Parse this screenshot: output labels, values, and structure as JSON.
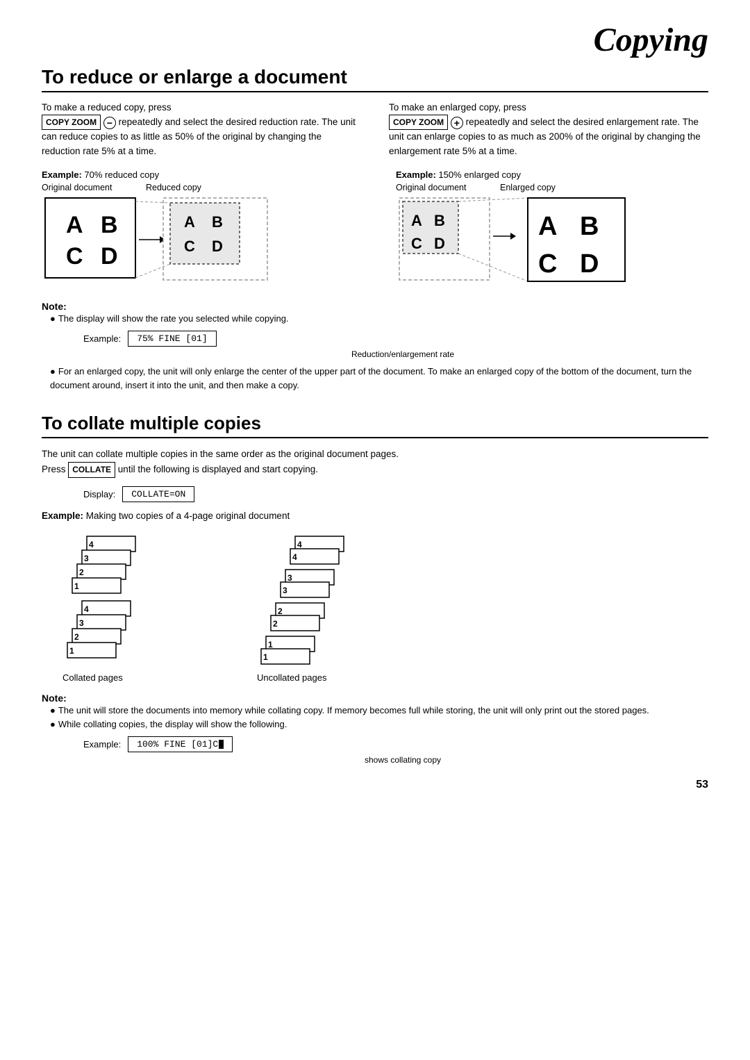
{
  "page": {
    "title": "Copying",
    "page_number": "53"
  },
  "section1": {
    "heading": "To reduce or enlarge a document",
    "left_col": {
      "intro": "To make a reduced copy, press",
      "button": "COPY ZOOM",
      "arrow_symbol": "−",
      "rest": "repeatedly and select the desired reduction rate. The unit can reduce copies to as little as 50% of the original by changing the reduction rate 5% at a time."
    },
    "right_col": {
      "intro": "To make an enlarged copy, press",
      "button": "COPY ZOOM",
      "arrow_symbol": "+",
      "rest": "repeatedly and select the desired enlargement rate. The unit can enlarge copies to as much as 200% of the original by changing the enlargement rate 5% at a time."
    },
    "reduce_example": {
      "label_bold": "Example:",
      "label_rest": " 70% reduced copy",
      "orig_label": "Original document",
      "copy_label": "Reduced copy",
      "orig_letters": [
        "A",
        "B",
        "C",
        "D"
      ],
      "copy_letters": [
        "A",
        "B",
        "C",
        "D"
      ]
    },
    "enlarge_example": {
      "label_bold": "Example:",
      "label_rest": " 150% enlarged copy",
      "orig_label": "Original document",
      "copy_label": "Enlarged copy",
      "orig_letters": [
        "A",
        "B",
        "C",
        "D"
      ],
      "copy_letters": [
        "A",
        "B",
        "C",
        "D"
      ]
    },
    "note_title": "Note:",
    "note1": "The display will show the rate you selected while copying.",
    "display_example_prefix": "Example:",
    "display_example_value": "75% FINE  [01]",
    "display_sub": "Reduction/enlargement rate",
    "note2": "For an enlarged copy, the unit will only enlarge the center of the upper part of the document. To make an enlarged copy of the bottom of the document, turn the document around, insert it into the unit, and then make a copy."
  },
  "section2": {
    "heading": "To collate multiple copies",
    "intro1": "The unit can collate multiple copies in the same order as the original document pages.",
    "intro2_pre": "Press ",
    "intro2_button": "COLLATE",
    "intro2_post": " until the following is displayed and start copying.",
    "display_prefix": "Display:",
    "display_value": "COLLATE=ON",
    "example_label_bold": "Example:",
    "example_label_rest": " Making two copies of a 4-page original document",
    "collated_label": "Collated pages",
    "uncollated_label": "Uncollated pages",
    "collated_numbers": [
      "4",
      "3",
      "2",
      "1",
      "4",
      "3",
      "2",
      "1"
    ],
    "uncollated_numbers": [
      "4",
      "4",
      "3",
      "3",
      "2",
      "2",
      "1",
      "1"
    ],
    "note_title": "Note:",
    "note1": "The unit will store the documents into memory while collating copy. If memory becomes full while storing, the unit will only print out the stored pages.",
    "note2": "While collating copies, the display will show the following.",
    "display2_prefix": "Example:",
    "display2_value": "100% FINE  [01]C",
    "display2_sub": "shows collating copy"
  }
}
